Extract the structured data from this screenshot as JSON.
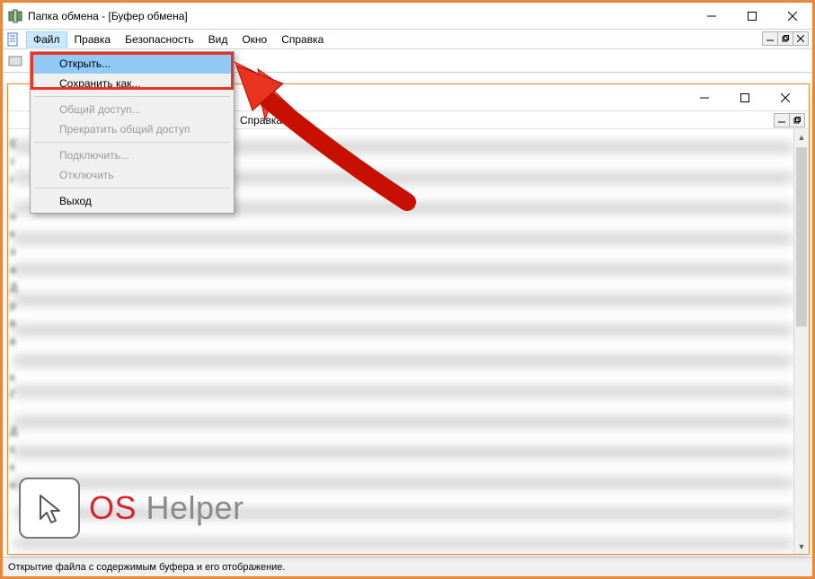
{
  "titlebar": {
    "title": "Папка обмена - [Буфер обмена]"
  },
  "menubar": {
    "items": [
      "Файл",
      "Правка",
      "Безопасность",
      "Вид",
      "Окно",
      "Справка"
    ],
    "active_index": 0
  },
  "dropdown": {
    "open": "Открыть...",
    "save_as": "Сохранить как...",
    "share": "Общий доступ...",
    "stop_share": "Прекратить общий доступ",
    "connect": "Подключить...",
    "disconnect": "Отключить",
    "exit": "Выход"
  },
  "child": {
    "menubar_item": "Справка"
  },
  "statusbar": {
    "text": "Открытие файла с содержимым буфера и его отображение."
  },
  "watermark": {
    "os": "OS",
    "helper": " Helper"
  }
}
